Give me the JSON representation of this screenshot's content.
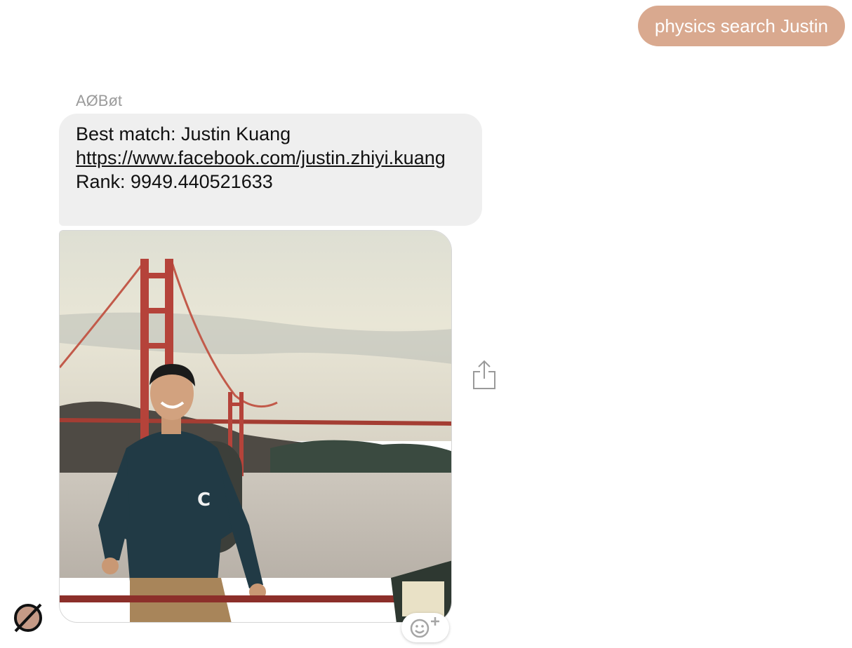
{
  "outgoing_message": {
    "text": "physics search Justin"
  },
  "incoming": {
    "sender": "AØBøt",
    "best_match_line": "Best match: Justin Kuang",
    "profile_link": "https://www.facebook.com/justin.zhiyi.kuang",
    "rank_line": "Rank: 9949.440521633"
  },
  "photo": {
    "subject": "man sitting in front of Golden Gate Bridge",
    "shirt_letter": "C"
  },
  "icons": {
    "share": "share-icon",
    "reaction": "add-reaction-icon",
    "avatar": "bot-avatar-icon"
  },
  "colors": {
    "outgoing_bubble": "#d9a98f",
    "incoming_bubble": "#efefef",
    "sender_name": "#9b9b9b",
    "bridge": "#b5433a"
  }
}
